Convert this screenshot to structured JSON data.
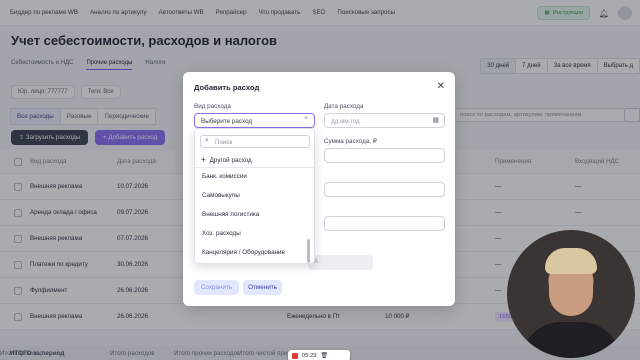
{
  "topnav": {
    "items": [
      "Биддер по рекламе WB",
      "Анализ по артикулу",
      "Автоответы WB",
      "Репрайсер",
      "Что продавать",
      "SEO",
      "Поисковые запросы"
    ],
    "instructions": "Инструкции"
  },
  "page": {
    "title": "Учет себестоимости, расходов и налогов",
    "subtabs": [
      "Себестоимость и НДС",
      "Прочие расходы",
      "Налоги"
    ],
    "periods": [
      "30 дней",
      "7 дней",
      "За все время",
      "Выбрать д"
    ],
    "filter_entity": "Юр. лицо: 777777",
    "filter_tags": "Теги: Все",
    "type_tabs": [
      "Все расходы",
      "Разовые",
      "Периодические"
    ],
    "search_placeholder": "поиск по расходам, артикулам, примечаниям",
    "load_button": "Загрузить расходы",
    "add_button": "Добавить расход"
  },
  "table": {
    "headers": [
      "Вид расхода",
      "Дата расхода",
      "",
      "",
      "Применения",
      "Входящий НДС"
    ],
    "rows": [
      {
        "type": "Внешняя реклама",
        "date": "10.07.2026",
        "c3": "",
        "c4": "",
        "apply": "—",
        "vat": "—"
      },
      {
        "type": "Аренда склада / офиса",
        "date": "09.07.2026",
        "c3": "",
        "c4": "",
        "apply": "—",
        "vat": "—"
      },
      {
        "type": "Внешняя реклама",
        "date": "07.07.2026",
        "c3": "",
        "c4": "",
        "apply": "—",
        "vat": "—"
      },
      {
        "type": "Платежи по кредиту",
        "date": "30.06.2026",
        "c3": "",
        "c4": "",
        "apply": "—",
        "vat": "—"
      },
      {
        "type": "Фулфилмент",
        "date": "26.06.2026",
        "c3": "",
        "c4": "",
        "apply": "—",
        "vat": "—"
      },
      {
        "type": "Внешняя реклама",
        "date": "26.06.2026",
        "c3": "Еженедельно в Пт",
        "c4": "10 000 ₽",
        "apply": "165017074",
        "vat": "—"
      }
    ],
    "total_label": "ИТОГО за период",
    "totals": [
      "Итого прочих р",
      "Итого расходов",
      "Итого прочих расходов",
      "Итого чистой приб"
    ]
  },
  "modal": {
    "title": "Добавить расход",
    "type_label": "Вид расхода",
    "type_placeholder": "Выберите расход",
    "date_label": "Дата расхода",
    "date_placeholder": "дд.мм.год",
    "amount_label": "Сумма расхода, ₽",
    "gray_button": "А",
    "save": "Сохранить",
    "cancel": "Отменить"
  },
  "dropdown": {
    "search_placeholder": "Поиск",
    "other": "Другой расход",
    "items": [
      "Банк. комиссии",
      "Самовыкупы",
      "Внешняя логистика",
      "Хоз. расходы",
      "Канцелярия / Оборудование"
    ]
  },
  "recorder": {
    "time": "05:29"
  }
}
